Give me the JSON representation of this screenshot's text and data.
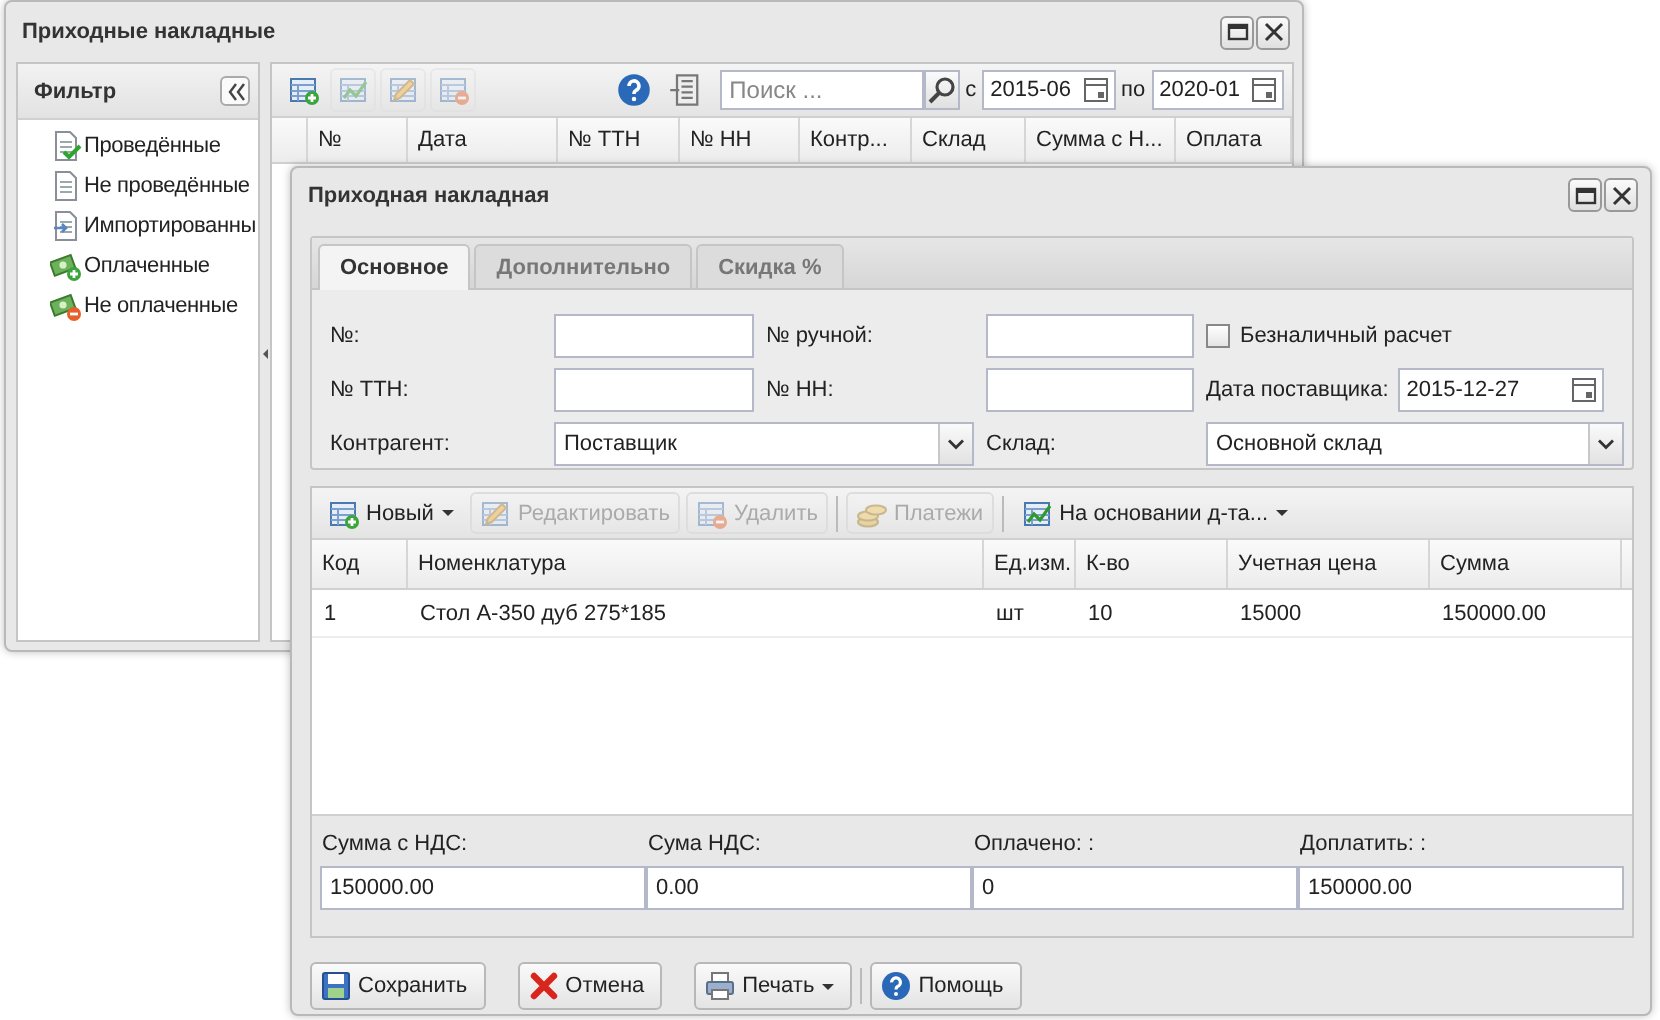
{
  "list_window": {
    "title": "Приходные накладные",
    "filter": {
      "title": "Фильтр",
      "items": [
        {
          "label": "Проведённые",
          "kind": "posted"
        },
        {
          "label": "Не проведённые",
          "kind": "unposted"
        },
        {
          "label": "Импортированны",
          "kind": "imported"
        },
        {
          "label": "Оплаченные",
          "kind": "paid"
        },
        {
          "label": "Не оплаченные",
          "kind": "unpaid"
        }
      ]
    },
    "toolbar": {
      "icon_buttons": [
        {
          "kind": "add",
          "disabled": false
        },
        {
          "kind": "chart",
          "disabled": true
        },
        {
          "kind": "edit",
          "disabled": true
        },
        {
          "kind": "delete",
          "disabled": true
        }
      ],
      "search": {
        "placeholder": "Поиск ..."
      },
      "from_label": "с",
      "from": "2015-06",
      "to_label": "по",
      "to": "2020-01"
    },
    "columns": [
      "№",
      "Дата",
      "№ ТТН",
      "№ НН",
      "Контр...",
      "Склад",
      "Сумма с Н...",
      "Оплата"
    ]
  },
  "dialog": {
    "title": "Приходная накладная",
    "tabs": [
      {
        "label": "Основное",
        "selected": true
      },
      {
        "label": "Дополнительно",
        "selected": false
      },
      {
        "label": "Скидка %",
        "selected": false
      }
    ],
    "form": [
      [
        {
          "kind": "text",
          "label": "№:"
        },
        {
          "kind": "text",
          "label": "№ ручной:"
        },
        {
          "kind": "checkbox",
          "label": "Безналичный расчет",
          "checked": false
        }
      ],
      [
        {
          "kind": "text",
          "label": "№ ТТН:"
        },
        {
          "kind": "text",
          "label": "№ НН:"
        },
        {
          "kind": "date",
          "label": "Дата поставщика:",
          "value": "2015-12-27"
        }
      ],
      [
        {
          "kind": "combo",
          "label": "Контрагент:",
          "value": "Поставщик"
        },
        {
          "kind": "combo",
          "label": "Склад:",
          "value": "Основной склад"
        }
      ]
    ],
    "toolbar": [
      [
        {
          "label": "Новый",
          "kind": "add",
          "disabled": false,
          "dropdown": true
        },
        {
          "label": "Редактировать",
          "kind": "edit",
          "disabled": true,
          "dropdown": false
        },
        {
          "label": "Удалить",
          "kind": "delete",
          "disabled": true,
          "dropdown": false
        }
      ],
      [
        {
          "label": "Платежи",
          "kind": "coins",
          "disabled": true,
          "dropdown": false
        }
      ],
      [
        {
          "label": "На основании д-та...",
          "kind": "chart",
          "disabled": false,
          "dropdown": true
        }
      ]
    ],
    "table": {
      "columns": [
        "Код",
        "Номенклатура",
        "Ед.изм.",
        "К-во",
        "Учетная цена",
        "Сумма"
      ],
      "rows": [
        [
          "1",
          "Стол А-350 дуб 275*185",
          "шт",
          "10",
          "15000",
          "150000.00"
        ]
      ]
    },
    "totals": [
      {
        "label": "Сумма с НДС:",
        "value": "150000.00"
      },
      {
        "label": "Сума НДС:",
        "value": "0.00"
      },
      {
        "label": "Оплачено: :",
        "value": "0"
      },
      {
        "label": "Доплатить: :",
        "value": "150000.00"
      }
    ],
    "buttons": [
      [
        {
          "label": "Сохранить",
          "kind": "save",
          "dropdown": false
        },
        {
          "label": "Отмена",
          "kind": "cancel",
          "dropdown": false
        },
        {
          "label": "Печать",
          "kind": "print",
          "dropdown": true
        }
      ],
      [
        {
          "label": "Помощь",
          "kind": "help",
          "dropdown": false
        }
      ]
    ]
  }
}
